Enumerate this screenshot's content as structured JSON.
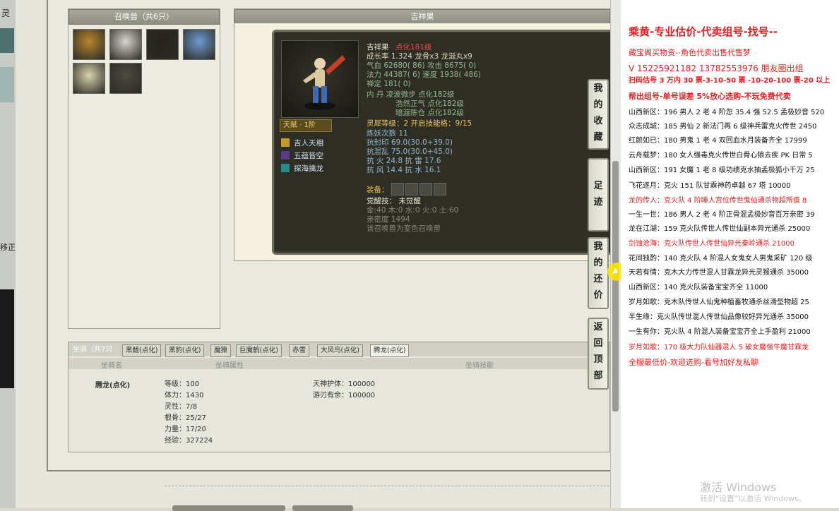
{
  "left_strip": {
    "title_fragment": "灵",
    "side_fragment": "移正"
  },
  "pet_panel": {
    "title": "召唤兽（共6只）",
    "pets": [
      {
        "name": "pet-1",
        "color": "#b8862e"
      },
      {
        "name": "pet-2",
        "color": "#d8d4d0"
      },
      {
        "name": "pet-3",
        "color": "#2a221c"
      },
      {
        "name": "pet-4",
        "color": "#6f9ad0"
      },
      {
        "name": "pet-5",
        "color": "#d8d2ac"
      },
      {
        "name": "pet-6",
        "color": "#4a4a40"
      }
    ]
  },
  "detail": {
    "title": "吉祥果",
    "name": "吉祥果",
    "rank": "点化181级",
    "growth": "成长率 1.324  龙骨x3  龙涎丸x9",
    "hp": "气血 62680( 86)  攻击 8675( 0)",
    "mp": "法力 44387( 6)  速度 1938( 486)",
    "chan": "禅定 181( 0)",
    "neidan_1": "内   丹  凌波微步 点化182级",
    "neidan_2": "浩然正气 点化182级",
    "neidan_3": "暗渡陈仓 点化182级",
    "soul": "灵犀等级：2  开启技能格：9/15",
    "refine": "炼妖次数 11",
    "resist_seal": "抗封印  69.0(30.0+39.0)",
    "resist_chaos": "抗混乱  75.0(30.0+45.0)",
    "resist_fire": "抗   火  24.8  抗   雷  17.6",
    "resist_wind": "抗   风  14.4  抗   水  16.1",
    "tianfu": "天赋 · 1阶",
    "skills": [
      "吉人天相",
      "五蕴皆空",
      "探海擒龙"
    ],
    "equip_label": "装备：",
    "awaken": "觉醒技：  未觉醒",
    "elements": "金:40  木:0  水:0  火:0  土:60",
    "intimacy": "亲密度 1494",
    "note": "该召唤兽为变色召唤兽"
  },
  "mount": {
    "count_label": "坐骑（共7只",
    "tabs": [
      "黑鳍(点化)",
      "黑豹(点化)",
      "魔猿",
      "巨魔鹤(点化)",
      "赤雪",
      "大风鸟(点化)",
      "腾龙(点化)"
    ],
    "active_tab": 6,
    "col_name": "坐骑名",
    "col_attr": "坐骑属性",
    "col_skill": "坐骑技能",
    "name": "腾龙(点化)",
    "level": "等级：100",
    "stamina": "体力：1430",
    "spirit": "灵性：7/8",
    "root": "根骨：25/27",
    "power": "力量：17/20",
    "exp": "经验：327224",
    "skill_1": "天神护体：100000",
    "skill_2": "游刃有余：100000"
  },
  "side_buttons": [
    "我的收藏",
    "足迹",
    "我的还价",
    "返回顶部"
  ],
  "doc": {
    "lines": [
      {
        "t": "乘黄-专业估价-代卖组号-找号--",
        "c": "red",
        "b": true,
        "s": 15
      },
      {
        "t": "藏宝阁买物资--角色代卖出售代售梦",
        "c": "red",
        "b": false,
        "s": 11
      },
      {
        "t": "V 15225921182   13782553976 朋友圈出组",
        "c": "red",
        "b": false,
        "s": 12
      },
      {
        "t": "扫码估号 3 万内 30 票-3-10-50 票 -10-20-100 票-20 以上",
        "c": "red",
        "b": true,
        "s": 10
      },
      {
        "t": "帮出组号-单号误差 5%放心选购-不玩免费代卖",
        "c": "red",
        "b": true,
        "s": 11
      },
      {
        "t": "山西新区：196 男人 2 老 4 阶忽 35.4 强 52.5 孟极妙音 520",
        "c": "blk",
        "b": false,
        "s": 10
      },
      {
        "t": "众志成城：185 男仙 2 新法门再 6 级神兵雷克火传世 2450",
        "c": "blk",
        "b": false,
        "s": 10
      },
      {
        "t": "红颜如已：180 男鬼 1 老 4 双回血水月装备齐全 17999",
        "c": "blk",
        "b": false,
        "s": 10
      },
      {
        "t": "云舟载梦：180 女人强毒克火传世白骨心狼去疾 PK 日常 5",
        "c": "blk",
        "b": false,
        "s": 10
      },
      {
        "t": "山西新区：191 女魔 1 老 8 级功绩克水抽孟极狐小千万 25",
        "c": "blk",
        "b": false,
        "s": 10
      },
      {
        "t": "飞花逐月：克火 151 队甘霖神药卓越 67 塔 10000",
        "c": "blk",
        "b": false,
        "s": 10
      },
      {
        "t": "龙的传人：克火队 4 阶睡人宫位传世鬼仙通杀物超所值 8",
        "c": "red",
        "b": false,
        "s": 10
      },
      {
        "t": "一生一世：186 男人 2 老 4 阶正骨混孟极妙音百万亲密 39",
        "c": "blk",
        "b": false,
        "s": 10
      },
      {
        "t": "龙在江湖：159 克火队传世人传世仙副本异光通杀 25000",
        "c": "blk",
        "b": false,
        "s": 10
      },
      {
        "t": "剑蚀沧海：克火队传世人传世仙异光秦岭通杀 21000",
        "c": "red",
        "b": false,
        "s": 10
      },
      {
        "t": "花间独酌：140 克火队 4 阶混人女鬼女人男鬼采矿 120 级",
        "c": "blk",
        "b": false,
        "s": 10
      },
      {
        "t": "天若有情：克木大力传世混人甘霖龙异光灵猴通杀 35000",
        "c": "blk",
        "b": false,
        "s": 10
      },
      {
        "t": "山西新区：140 克火队装备宝宝齐全 11000",
        "c": "blk",
        "b": false,
        "s": 10
      },
      {
        "t": "岁月如歌：克木队传世人仙鬼种植畜牧通杀丝滑型物超 25",
        "c": "blk",
        "b": false,
        "s": 10
      },
      {
        "t": "半生缘：克火队传世混人传世仙品像较好异光通杀 35000",
        "c": "blk",
        "b": false,
        "s": 10
      },
      {
        "t": "一生有你：克火队 4 阶混人装备宝宝齐全上手盈利 21000",
        "c": "blk",
        "b": false,
        "s": 10
      },
      {
        "t": "岁月如歌：170 级大力队仙器混人 5 破女魔强牛魔甘霖龙",
        "c": "red",
        "b": false,
        "s": 10
      },
      {
        "t": "全服最低价-欢迎选购-看号加好友私聊",
        "c": "red",
        "b": false,
        "s": 11
      }
    ],
    "watermark_1": "激活 Windows",
    "watermark_2": "转到\"设置\"以激活 Windows。"
  }
}
